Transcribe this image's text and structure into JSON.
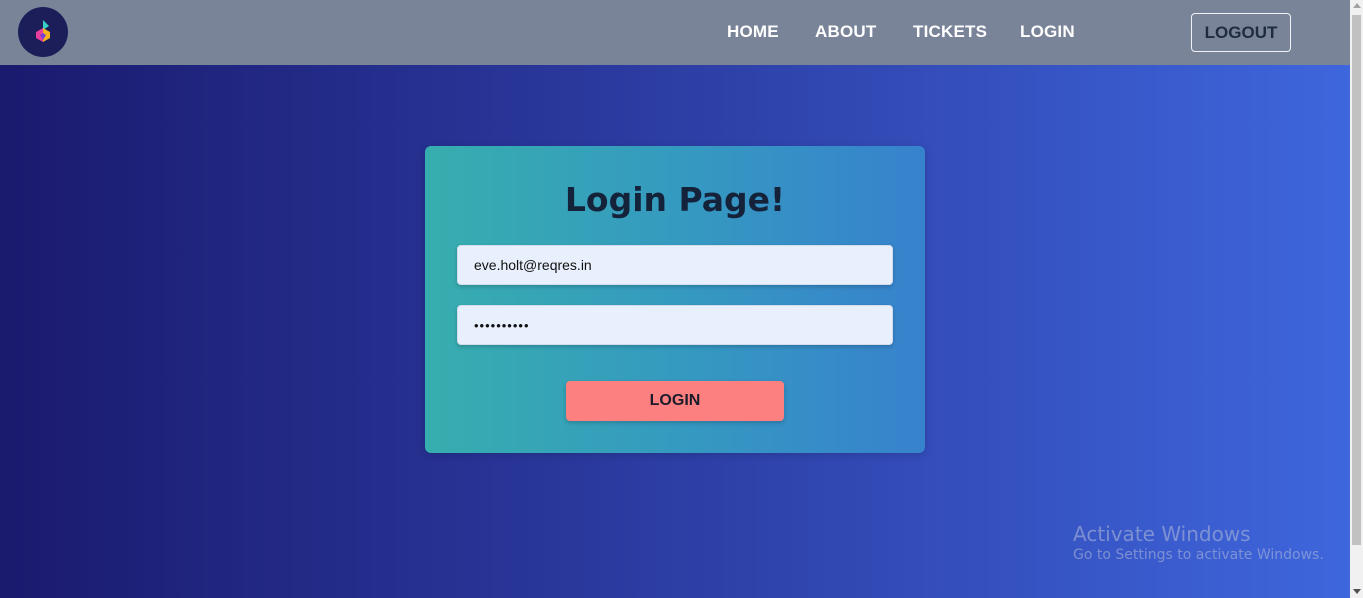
{
  "navbar": {
    "logo_icon": "flame-logo-icon",
    "links": [
      "HOME",
      "ABOUT",
      "TICKETS",
      "LOGIN"
    ],
    "logout_label": "LOGOUT"
  },
  "login_card": {
    "title": "Login Page!",
    "email_value": "eve.holt@reqres.in",
    "password_value": "••••••••••",
    "submit_label": "LOGIN"
  },
  "watermark": {
    "title": "Activate Windows",
    "subtitle": "Go to Settings to activate Windows."
  },
  "colors": {
    "navbar": "#7a8499",
    "card_gradient_start": "#37aeae",
    "card_gradient_end": "#3782cd",
    "login_button": "#fd8080",
    "background_start": "#1a1a6e",
    "background_end": "#3f67de"
  }
}
